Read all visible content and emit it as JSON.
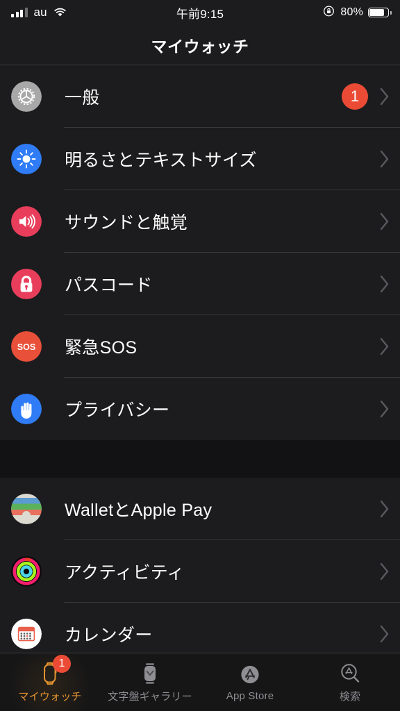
{
  "status_bar": {
    "carrier": "au",
    "time": "午前9:15",
    "battery_percent": "80%",
    "battery_level": 80,
    "signal_bars_filled": 3,
    "signal_bars_total": 4,
    "wifi_icon": "wifi-icon",
    "rotation_lock_icon": "rotation-lock-icon"
  },
  "navbar": {
    "title": "マイウォッチ"
  },
  "colors": {
    "accent": "#e2922f",
    "badge_red": "#eb4b35",
    "row_bg": "#1c1c1e",
    "separator": "#39393c",
    "text": "#ffffff",
    "chevron": "#8e8e93"
  },
  "sections": [
    {
      "id": "settings-section",
      "rows": [
        {
          "label": "一般",
          "icon": "gear-icon",
          "badge": "1",
          "chevron": true
        },
        {
          "label": "明るさとテキストサイズ",
          "icon": "brightness-icon",
          "badge": null,
          "chevron": true
        },
        {
          "label": "サウンドと触覚",
          "icon": "sound-icon",
          "badge": null,
          "chevron": true
        },
        {
          "label": "パスコード",
          "icon": "lock-icon",
          "badge": null,
          "chevron": true
        },
        {
          "label": "緊急SOS",
          "icon": "sos-icon",
          "badge": null,
          "chevron": true
        },
        {
          "label": "プライバシー",
          "icon": "privacy-hand-icon",
          "badge": null,
          "chevron": true
        }
      ]
    },
    {
      "id": "apps-section",
      "rows": [
        {
          "label": "WalletとApple Pay",
          "icon": "wallet-icon",
          "badge": null,
          "chevron": true
        },
        {
          "label": "アクティビティ",
          "icon": "activity-rings-icon",
          "badge": null,
          "chevron": true
        },
        {
          "label": "カレンダー",
          "icon": "calendar-icon",
          "badge": null,
          "chevron": true
        }
      ]
    }
  ],
  "tabbar": {
    "tabs": [
      {
        "label": "マイウォッチ",
        "icon": "watch-icon",
        "active": true,
        "badge": "1"
      },
      {
        "label": "文字盤ギャラリー",
        "icon": "watch-face-icon",
        "active": false,
        "badge": null
      },
      {
        "label": "App Store",
        "icon": "app-store-icon",
        "active": false,
        "badge": null
      },
      {
        "label": "検索",
        "icon": "search-icon",
        "active": false,
        "badge": null
      }
    ]
  }
}
